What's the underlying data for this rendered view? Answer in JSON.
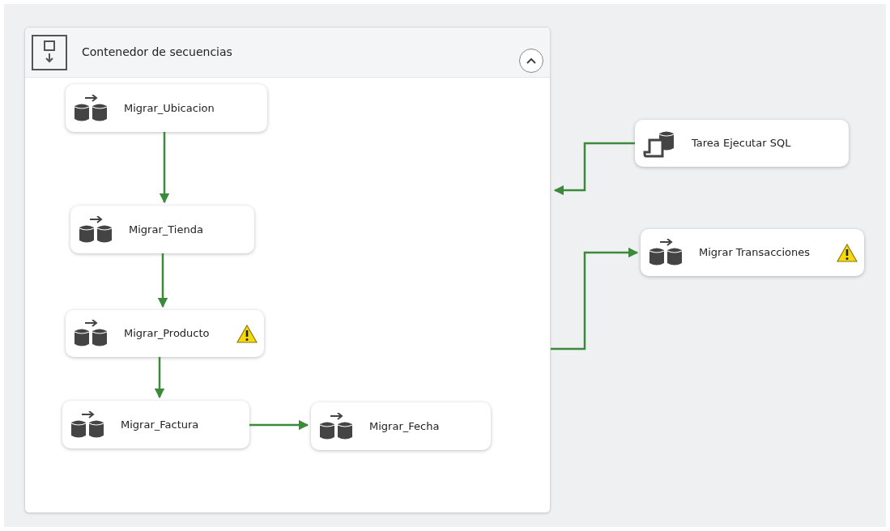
{
  "container": {
    "title": "Contenedor de secuencias",
    "expanded": true,
    "tasks": [
      {
        "kind": "data_flow",
        "label": "Migrar_Ubicacion",
        "warning": false
      },
      {
        "kind": "data_flow",
        "label": "Migrar_Tienda",
        "warning": false
      },
      {
        "kind": "data_flow",
        "label": "Migrar_Producto",
        "warning": true
      },
      {
        "kind": "data_flow",
        "label": "Migrar_Factura",
        "warning": false
      },
      {
        "kind": "data_flow",
        "label": "Migrar_Fecha",
        "warning": false
      }
    ]
  },
  "tasks": [
    {
      "kind": "sql",
      "label": "Tarea Ejecutar SQL",
      "warning": false
    },
    {
      "kind": "data_flow",
      "label": "Migrar Transacciones",
      "warning": true
    }
  ]
}
